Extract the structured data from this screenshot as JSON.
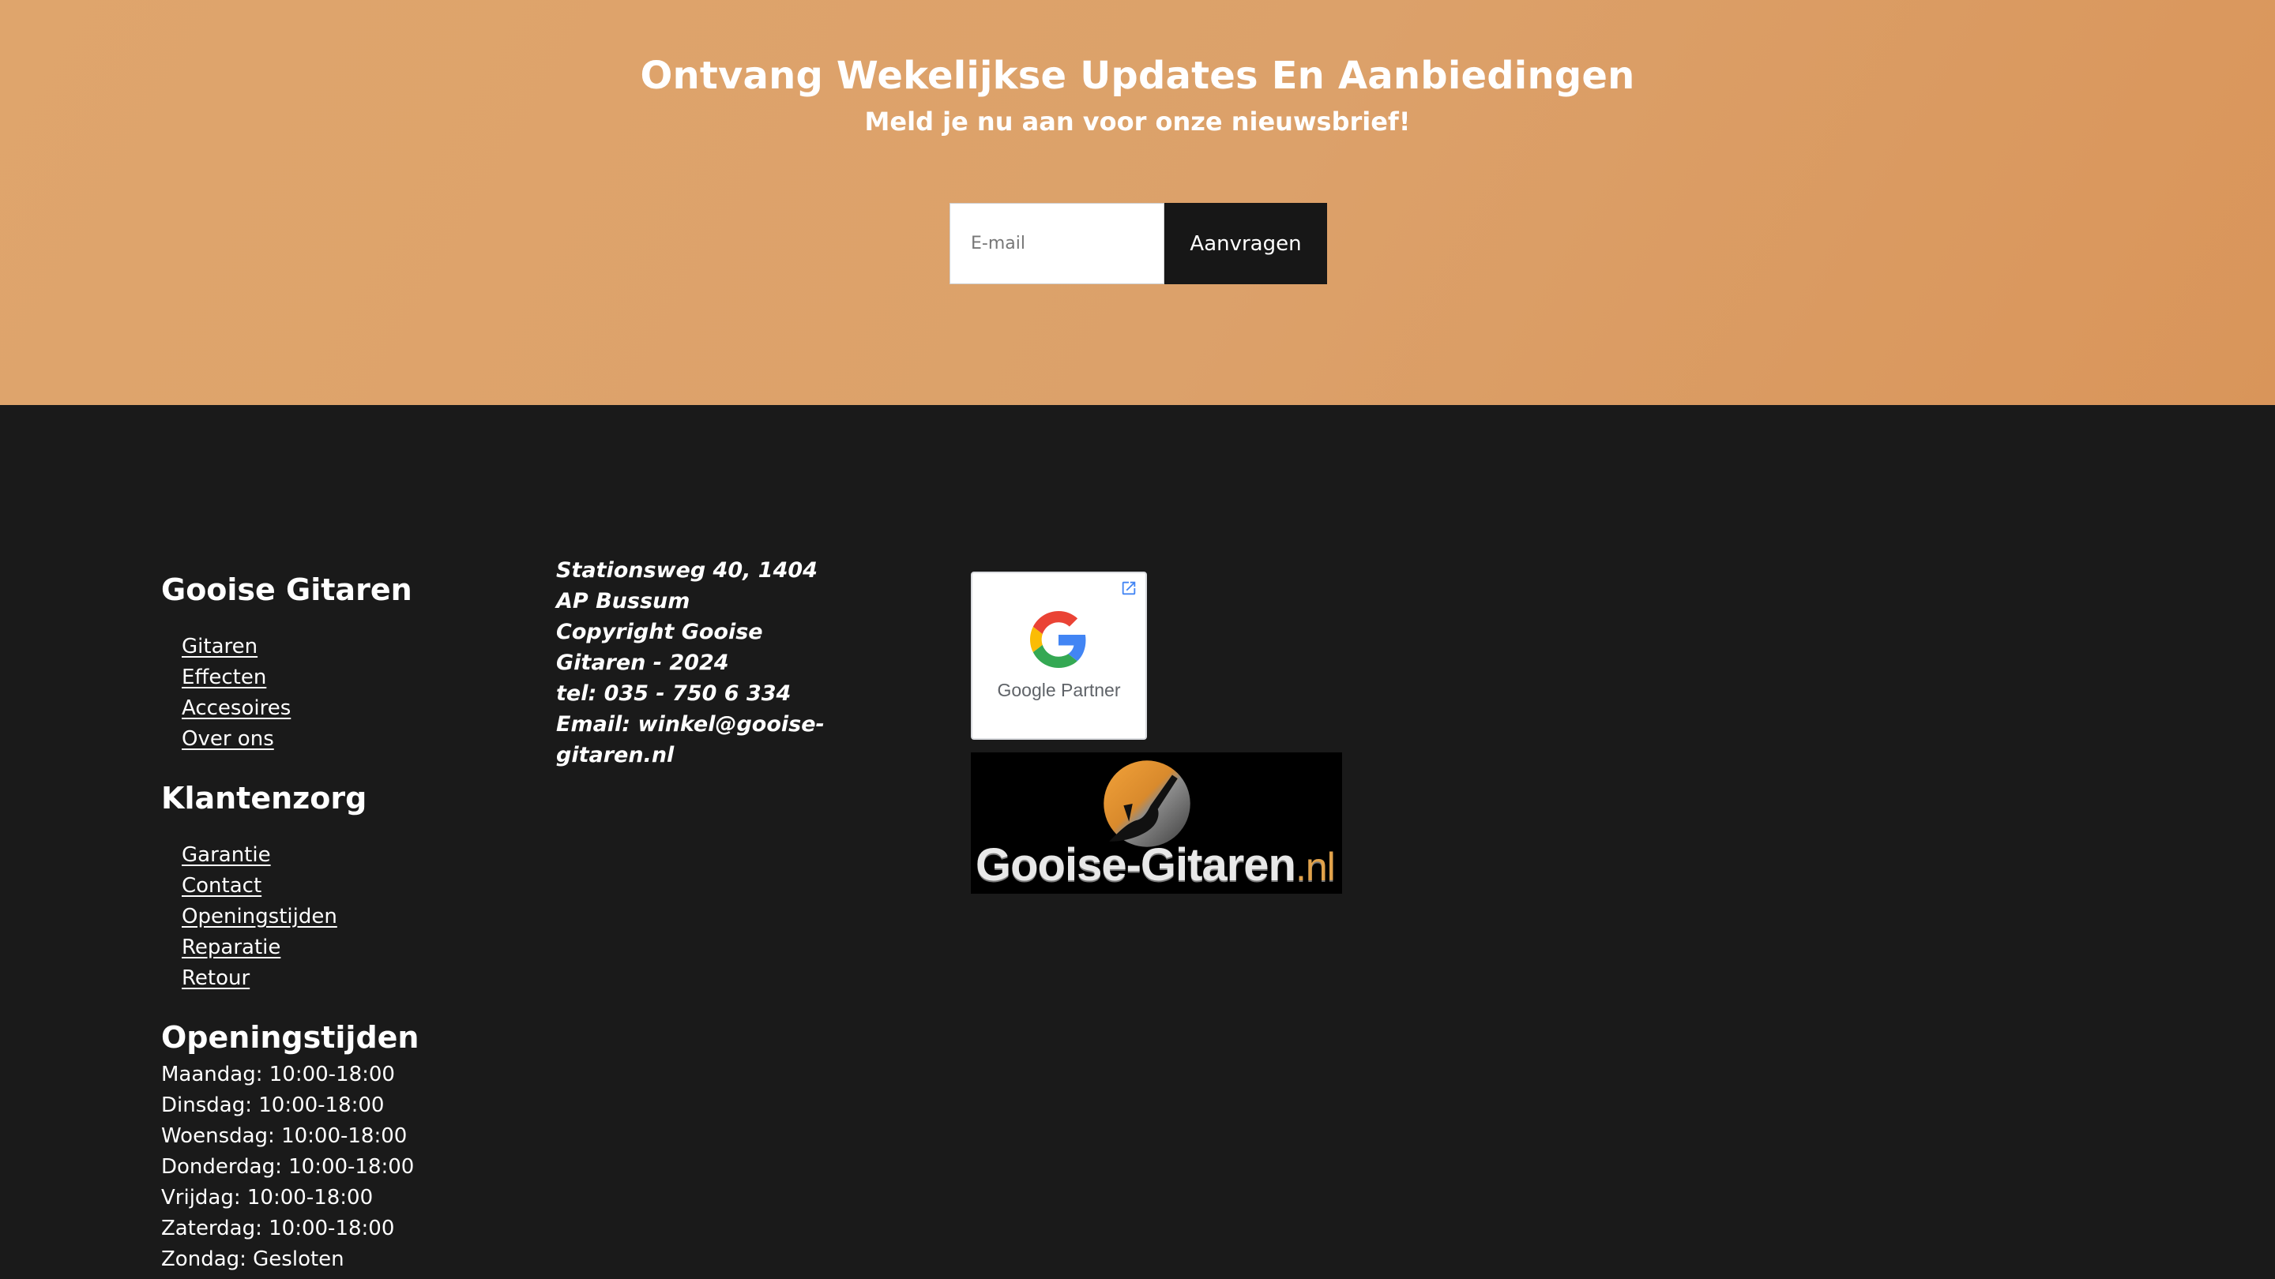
{
  "newsletter": {
    "title": "Ontvang Wekelijkse Updates En Aanbiedingen",
    "subtitle": "Meld je nu aan voor onze nieuwsbrief!",
    "email_placeholder": "E-mail",
    "email_value": "",
    "submit_label": "Aanvragen"
  },
  "footer": {
    "shop": {
      "heading": "Gooise Gitaren",
      "links": [
        "Gitaren",
        "Effecten",
        "Accesoires",
        "Over ons"
      ]
    },
    "service": {
      "heading": "Klantenzorg",
      "links": [
        "Garantie",
        "Contact",
        "Openingstijden",
        "Reparatie",
        "Retour"
      ]
    },
    "hours": {
      "heading": "Openingstijden",
      "days": [
        "Maandag: 10:00-18:00",
        "Dinsdag: 10:00-18:00",
        "Woensdag: 10:00-18:00",
        "Donderdag: 10:00-18:00",
        "Vrijdag: 10:00-18:00",
        "Zaterdag: 10:00-18:00",
        "Zondag: Gesloten"
      ]
    },
    "contact": {
      "address": "Stationsweg 40, 1404 AP Bussum",
      "copyright": "Copyright Gooise Gitaren - 2024",
      "phone": "tel: 035 - 750 6 334",
      "email": "Email: winkel@gooise-gitaren.nl"
    },
    "badges": {
      "google_partner_label": "Google Partner",
      "brand_logo_text": "Gooise-Gitaren",
      "brand_logo_tld": ".nl"
    }
  },
  "colors": {
    "newsletter_bg": "#dca16a",
    "footer_bg": "#1a1a1a",
    "button_bg": "#171717",
    "brand_orange": "#e2a24a"
  }
}
